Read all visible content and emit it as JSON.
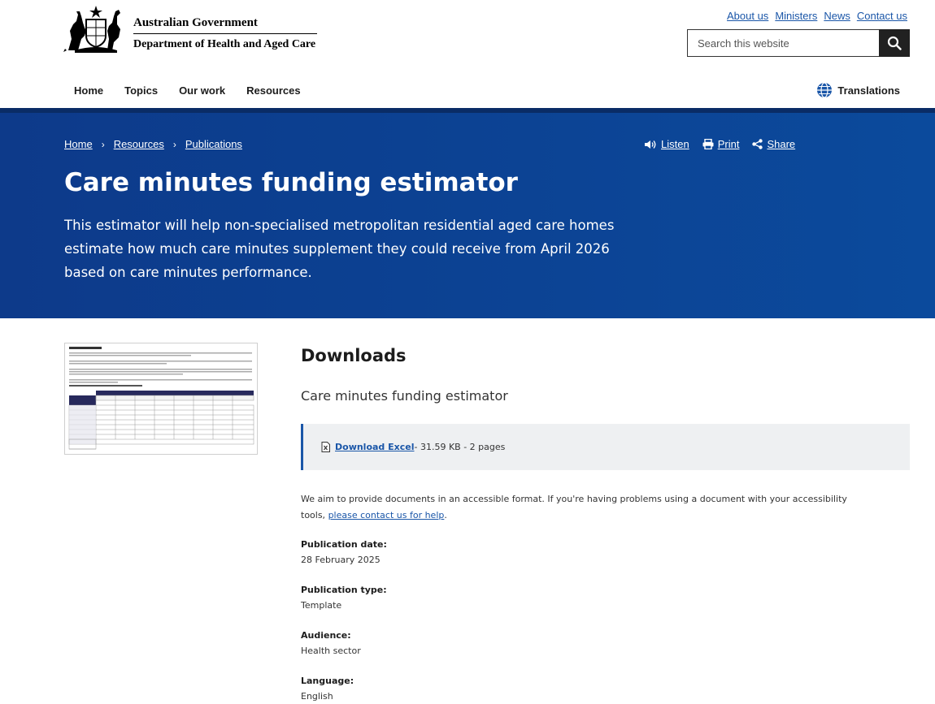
{
  "header": {
    "gov_name": "Australian Government",
    "dept_name": "Department of Health and Aged Care",
    "util_links": [
      "About us",
      "Ministers",
      "News",
      "Contact us"
    ],
    "search_placeholder": "Search this website",
    "nav": [
      "Home",
      "Topics",
      "Our work",
      "Resources"
    ],
    "translations": "Translations"
  },
  "hero": {
    "breadcrumb": [
      "Home",
      "Resources",
      "Publications"
    ],
    "actions": {
      "listen": "Listen",
      "print": "Print",
      "share": "Share"
    },
    "title": "Care minutes funding estimator",
    "intro": "This estimator will help non-specialised metropolitan residential aged care homes estimate how much care minutes supplement they could receive from April 2026 based on care minutes performance."
  },
  "main": {
    "downloads_heading": "Downloads",
    "doc_title": "Care minutes funding estimator",
    "download_link": "Download Excel",
    "download_meta": " - 31.59 KB - 2 pages",
    "access_text": "We aim to provide documents in an accessible format. If you're having problems using a document with your accessibility tools, ",
    "access_link": "please contact us for help",
    "access_end": ".",
    "meta": [
      {
        "label": "Publication date:",
        "value": "28 February 2025"
      },
      {
        "label": "Publication type:",
        "value": "Template"
      },
      {
        "label": "Audience:",
        "value": "Health sector"
      },
      {
        "label": "Language:",
        "value": "English"
      }
    ]
  },
  "colors": {
    "hero_bg": "#0b4a9c",
    "link": "#1a56a8",
    "dark": "#212121"
  }
}
